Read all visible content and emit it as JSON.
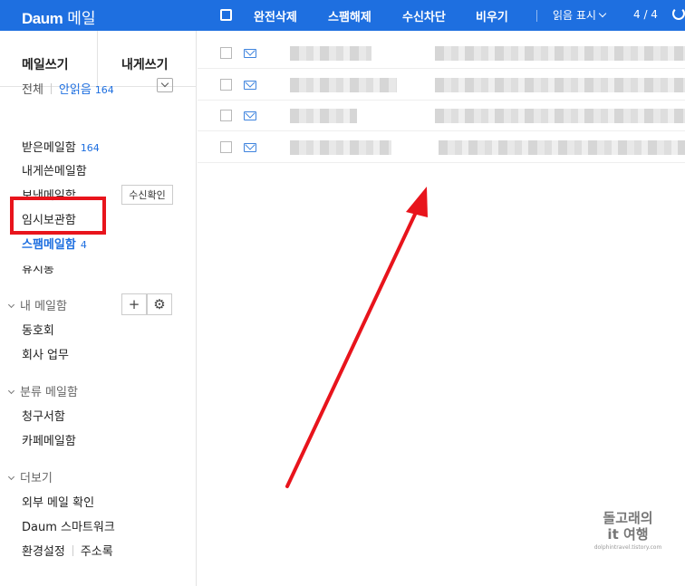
{
  "header": {
    "brand": "Daum",
    "service": "메일",
    "actions": [
      "완전삭제",
      "스팸해제",
      "수신차단",
      "비우기"
    ],
    "read_filter": "읽음 표시",
    "page_indicator": "4 / 4"
  },
  "sidebar": {
    "compose": "메일쓰기",
    "compose_self": "내게쓰기",
    "summary": {
      "all": "전체",
      "unread": "안읽음",
      "unread_count": "164"
    },
    "folders": [
      {
        "label": "받은메일함",
        "count": "164"
      },
      {
        "label": "내게쓴메일함",
        "count": ""
      },
      {
        "label": "보낸메일함",
        "count": ""
      },
      {
        "label": "임시보관함",
        "count": ""
      },
      {
        "label": "스팸메일함",
        "count": "4"
      },
      {
        "label": "휴지통",
        "count": ""
      }
    ],
    "receipt_button": "수신확인",
    "my_mailboxes": {
      "title": "내 메일함",
      "items": [
        "동호회",
        "회사 업무"
      ]
    },
    "category_mailboxes": {
      "title": "분류 메일함",
      "items": [
        "청구서함",
        "카페메일함"
      ]
    },
    "more": {
      "title": "더보기",
      "items": [
        "외부 메일 확인",
        "Daum 스마트워크",
        "환경설정",
        "주소록"
      ]
    }
  },
  "mail_list": {
    "row_count": 4
  },
  "watermark": {
    "line1": "돌고래의",
    "line2": "it 여행",
    "line3": "dolphintravel.tistory.com"
  },
  "colors": {
    "brand_blue": "#1e6fe0",
    "highlight_red": "#e8141c"
  }
}
